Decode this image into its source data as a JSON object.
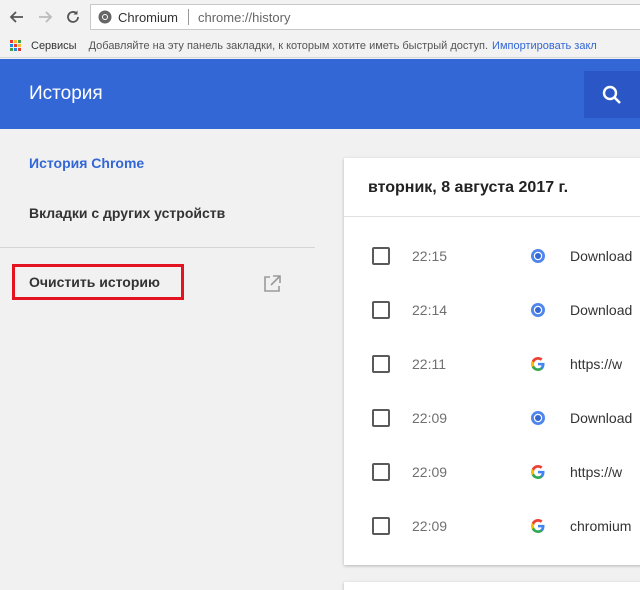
{
  "browser": {
    "site_name": "Chromium",
    "url": "chrome://history"
  },
  "bookmarks_bar": {
    "services": "Сервисы",
    "hint": "Добавляйте на эту панель закладки, к которым хотите иметь быстрый доступ.",
    "import_link": "Импортировать закл"
  },
  "header": {
    "title": "История"
  },
  "sidebar": {
    "history_chrome": "История Chrome",
    "other_devices": "Вкладки с других устройств",
    "clear_history": "Очистить историю"
  },
  "history": {
    "date": "вторник, 8 августа 2017 г.",
    "rows": [
      {
        "time": "22:15",
        "icon": "chromium-icon",
        "title": "Download"
      },
      {
        "time": "22:14",
        "icon": "chromium-icon",
        "title": "Download"
      },
      {
        "time": "22:11",
        "icon": "google-icon",
        "title": "https://w"
      },
      {
        "time": "22:09",
        "icon": "chromium-icon",
        "title": "Download"
      },
      {
        "time": "22:09",
        "icon": "google-icon",
        "title": "https://w"
      },
      {
        "time": "22:09",
        "icon": "google-icon",
        "title": "chromium"
      }
    ]
  },
  "colors": {
    "accent": "#3367d6",
    "highlight": "#e3131f"
  }
}
